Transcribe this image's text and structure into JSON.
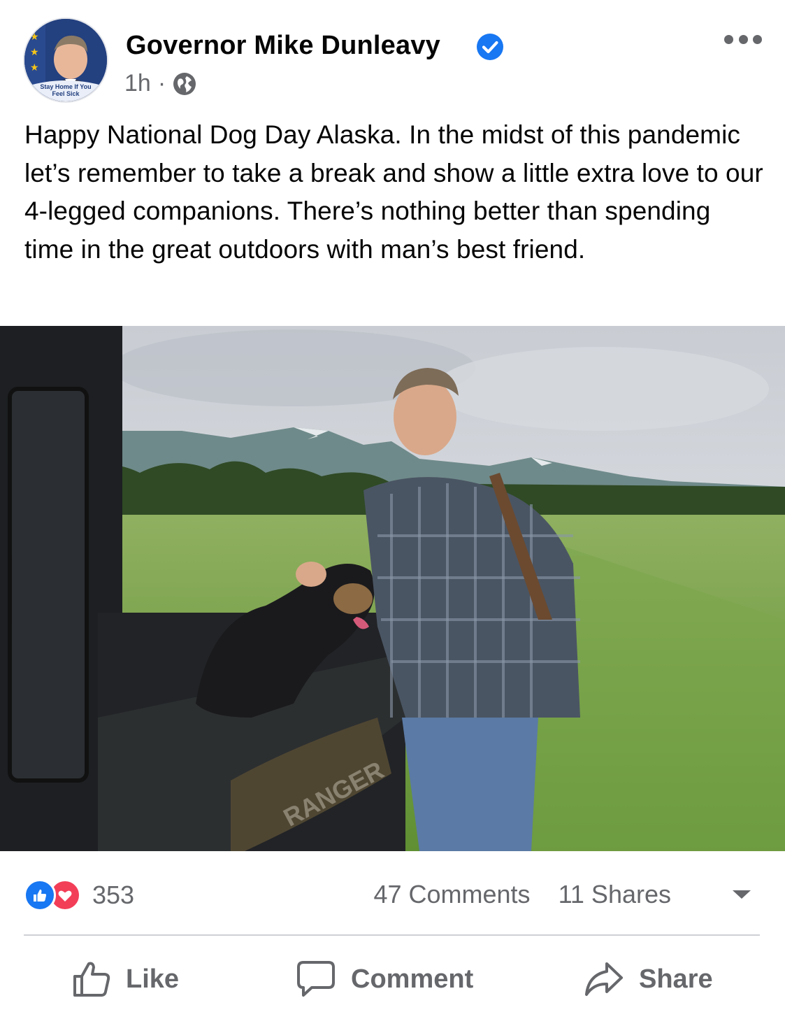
{
  "post": {
    "author": "Governor Mike Dunleavy",
    "avatar_badge": "Stay Home If You Feel Sick",
    "time": "1h",
    "separator": "·",
    "audience_icon": "globe-icon",
    "verified_icon": "verified-badge-icon",
    "more_icon": "more-options-icon",
    "text": "Happy National Dog Day Alaska. In the midst of this pandemic let’s remember to take a break and show a little extra love to our 4-legged companions. There’s nothing better than spending time in the great outdoors with man’s best friend."
  },
  "photo": {
    "vehicle_text": "RANGER"
  },
  "engagement": {
    "reaction_icons": [
      "like-reaction-icon",
      "love-reaction-icon"
    ],
    "reaction_count": "353",
    "comments": "47 Comments",
    "shares": "11 Shares"
  },
  "actions": {
    "like": "Like",
    "comment": "Comment",
    "share": "Share"
  },
  "colors": {
    "verified": "#1877f2",
    "like": "#1877f2",
    "love": "#f33e58",
    "secondary_text": "#65676b"
  }
}
